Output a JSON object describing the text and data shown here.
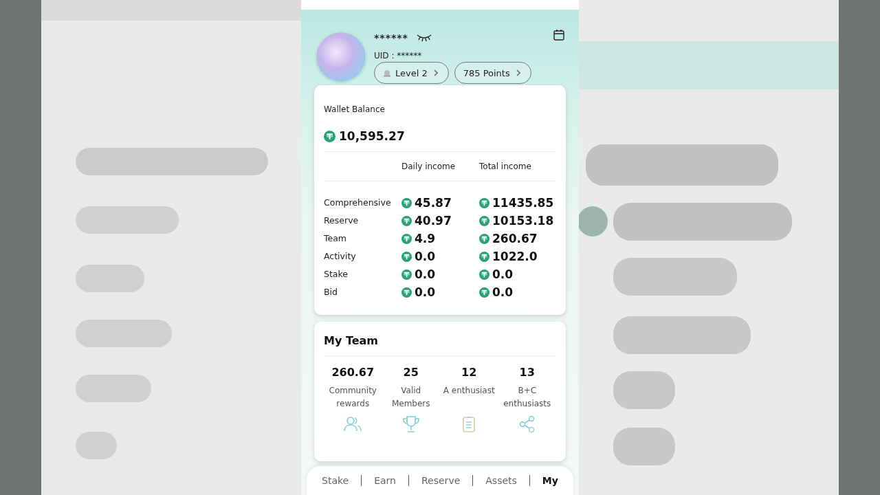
{
  "profile": {
    "name": "******",
    "uid": "UID : ******",
    "level": "Level 2",
    "points": "785 Points"
  },
  "wallet": {
    "title": "Wallet Balance",
    "balance": "10,595.27",
    "columns": [
      "Daily income",
      "Total income"
    ],
    "rows": [
      {
        "label": "Comprehensive",
        "daily": "45.87",
        "total": "11435.85"
      },
      {
        "label": "Reserve",
        "daily": "40.97",
        "total": "10153.18"
      },
      {
        "label": "Team",
        "daily": "4.9",
        "total": "260.67"
      },
      {
        "label": "Activity",
        "daily": "0.0",
        "total": "1022.0"
      },
      {
        "label": "Stake",
        "daily": "0.0",
        "total": "0.0"
      },
      {
        "label": "Bid",
        "daily": "0.0",
        "total": "0.0"
      }
    ]
  },
  "team": {
    "title": "My Team",
    "stats": [
      {
        "value": "260.67",
        "label": "Community rewards"
      },
      {
        "value": "25",
        "label": "Valid Members"
      },
      {
        "value": "12",
        "label": "A enthusiast"
      },
      {
        "value": "13",
        "label": "B+C enthusiasts"
      }
    ],
    "shortcuts": [
      {
        "kind": "people"
      },
      {
        "kind": "trophy"
      },
      {
        "kind": "clipboard"
      },
      {
        "kind": "share"
      }
    ]
  },
  "nav": [
    {
      "label": "Stake",
      "selected": false
    },
    {
      "label": "Earn",
      "selected": false
    },
    {
      "label": "Reserve",
      "selected": false
    },
    {
      "label": "Assets",
      "selected": false
    },
    {
      "label": "My",
      "selected": true
    }
  ]
}
